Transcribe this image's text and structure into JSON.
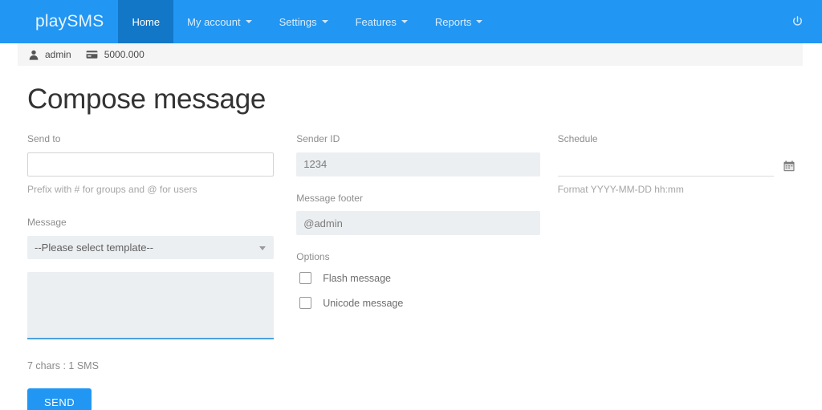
{
  "navbar": {
    "brand": "playSMS",
    "items": [
      {
        "label": "Home",
        "active": true,
        "caret": false
      },
      {
        "label": "My account",
        "active": false,
        "caret": true
      },
      {
        "label": "Settings",
        "active": false,
        "caret": true
      },
      {
        "label": "Features",
        "active": false,
        "caret": true
      },
      {
        "label": "Reports",
        "active": false,
        "caret": true
      }
    ],
    "logout_icon": "power-icon",
    "bg_color": "#2196f3",
    "active_bg_color": "#1277c7"
  },
  "subbar": {
    "user_icon": "user-icon",
    "username": "admin",
    "credit_icon": "credit-card-icon",
    "credit": "5000.000"
  },
  "page": {
    "title": "Compose message"
  },
  "form": {
    "send_to": {
      "label": "Send to",
      "value": "",
      "placeholder": "",
      "help": "Prefix with # for groups and @ for users"
    },
    "message": {
      "label": "Message",
      "template_selected": "--Please select template--",
      "template_options": [
        "--Please select template--"
      ],
      "value": "",
      "placeholder": "",
      "char_count": "7 chars : 1 SMS"
    },
    "sender_id": {
      "label": "Sender ID",
      "value": "1234",
      "placeholder": ""
    },
    "message_footer": {
      "label": "Message footer",
      "value": "@admin",
      "placeholder": ""
    },
    "options": {
      "label": "Options",
      "items": [
        {
          "label": "Flash message",
          "checked": false
        },
        {
          "label": "Unicode message",
          "checked": false
        }
      ]
    },
    "schedule": {
      "label": "Schedule",
      "value": "",
      "placeholder": "",
      "calendar_icon": "calendar-icon",
      "help": "Format YYYY-MM-DD hh:mm"
    },
    "submit": {
      "label": "SEND",
      "color": "#2196f3"
    }
  }
}
